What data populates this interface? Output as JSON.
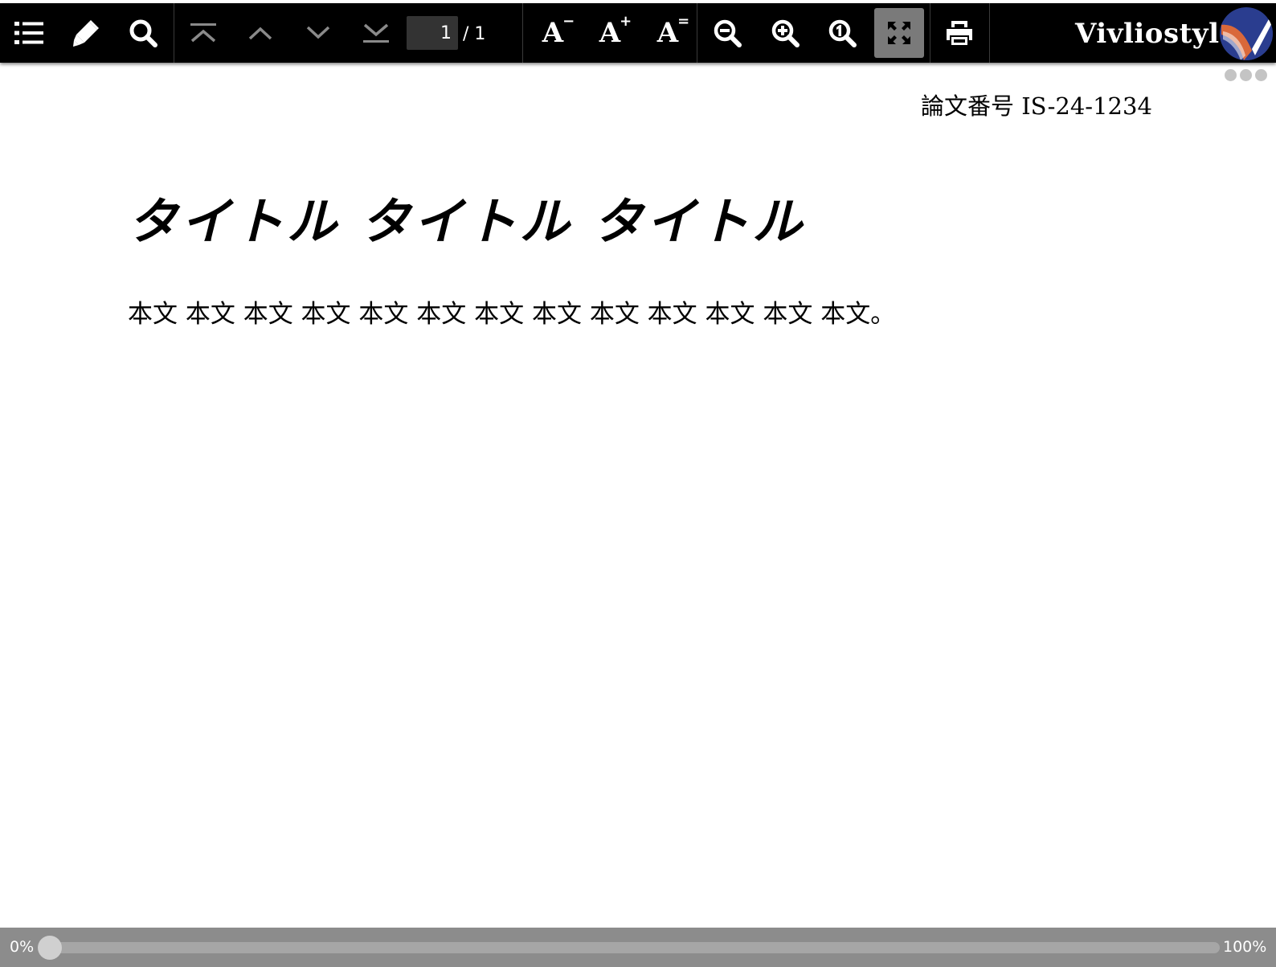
{
  "toolbar": {
    "buttons": [
      {
        "name": "toc-button",
        "icon": "list-icon",
        "enabled": true
      },
      {
        "name": "marker-button",
        "icon": "marker-pen-icon",
        "enabled": true
      },
      {
        "name": "search-button",
        "icon": "search-icon",
        "enabled": true
      },
      {
        "name": "first-page-button",
        "icon": "first-page-icon",
        "enabled": false
      },
      {
        "name": "previous-page-button",
        "icon": "chevron-up-icon",
        "enabled": false
      },
      {
        "name": "next-page-button",
        "icon": "chevron-down-icon",
        "enabled": false
      },
      {
        "name": "last-page-button",
        "icon": "last-page-icon",
        "enabled": false
      },
      {
        "name": "font-size-decrease-button",
        "icon": "font-smaller-icon",
        "enabled": true
      },
      {
        "name": "font-size-increase-button",
        "icon": "font-larger-icon",
        "enabled": true
      },
      {
        "name": "font-size-reset-button",
        "icon": "font-default-icon",
        "enabled": true
      },
      {
        "name": "zoom-out-button",
        "icon": "zoom-out-icon",
        "enabled": true
      },
      {
        "name": "zoom-in-button",
        "icon": "zoom-in-icon",
        "enabled": true
      },
      {
        "name": "actual-size-button",
        "icon": "zoom-actual-size-icon",
        "enabled": true
      },
      {
        "name": "fit-to-screen-button",
        "icon": "fit-screen-icon",
        "enabled": true,
        "active": true
      },
      {
        "name": "print-button",
        "icon": "print-icon",
        "enabled": true
      }
    ],
    "font_size": {
      "decrease_label": "A",
      "decrease_mark": "−",
      "increase_label": "A",
      "increase_mark": "+",
      "reset_label": "A",
      "reset_mark": "="
    },
    "page_navigation": {
      "current_page": "1",
      "total_display": "/ 1"
    },
    "brand": {
      "name": "Vivliostyle",
      "logo_icon": "vivliostyle-logo-icon"
    }
  },
  "document": {
    "paper_number": "論文番号 IS-24-1234",
    "title": "タイトル タイトル タイトル",
    "body": "本文 本文 本文 本文 本文 本文 本文 本文 本文 本文 本文 本文 本文。"
  },
  "progress": {
    "start_label": "0%",
    "end_label": "100%",
    "value": 0
  },
  "colors": {
    "toolbar_background": "#000000",
    "toolbar_icon": "#ffffff",
    "toolbar_icon_disabled": "#8a8a8a",
    "active_button_background": "#7a7a7a",
    "progress_bar_background": "#8c8c8c",
    "logo_blue": "#2a3d8f",
    "logo_orange": "#d9683a"
  }
}
